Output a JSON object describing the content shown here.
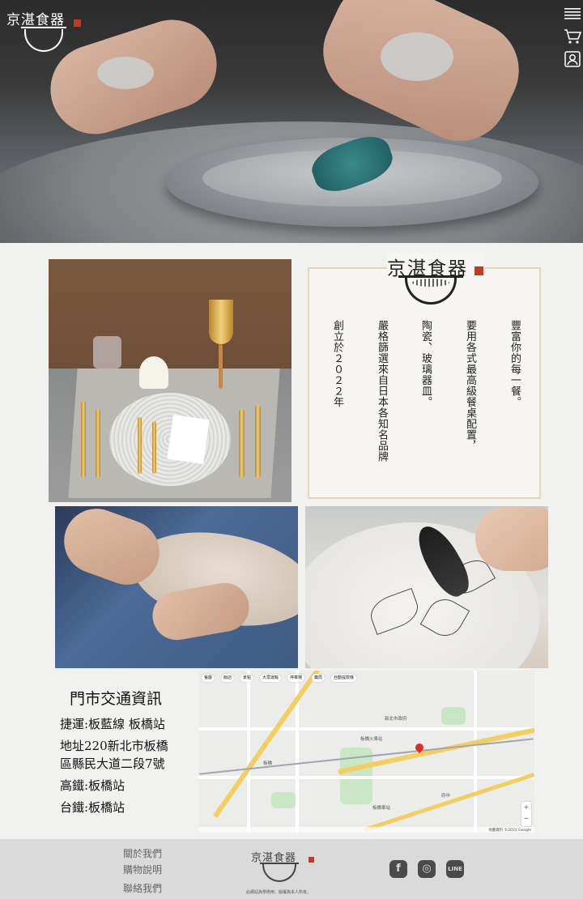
{
  "brand": {
    "logo_text": "京湛食器"
  },
  "nav": {
    "menu_icon": "hamburger-icon",
    "cart_icon": "cart-icon",
    "account_icon": "user-icon"
  },
  "intro": {
    "columns": [
      "豐富你的每一餐。",
      "要用各式最高級餐桌配置，",
      "陶瓷、玻璃器皿。",
      "嚴格篩選來自日本各知名品牌",
      "創立於２０２２年"
    ]
  },
  "store": {
    "title": "門市交通資訊",
    "mrt": "捷運:板藍線 板橋站",
    "address_line1": "地址220新北市板橋",
    "address_line2": "區縣民大道二段7號",
    "hsr": "高鐵:板橋站",
    "tra": "台鐵:板橋站"
  },
  "map": {
    "chips": [
      "餐廳",
      "飯店",
      "景點",
      "大眾運輸",
      "停車場",
      "藥局",
      "自動提款機"
    ],
    "labels": [
      "板橋火車站",
      "新北市政府",
      "板橋車站",
      "府中",
      "板橋"
    ],
    "attribution": "地圖資料 ©2022 Google"
  },
  "footer": {
    "links": [
      "關於我們",
      "購物說明",
      "聯絡我們"
    ],
    "copyright": "此網站為學術用、版權為本人所有。",
    "social": [
      {
        "name": "facebook-icon",
        "glyph": "f"
      },
      {
        "name": "instagram-icon",
        "glyph": "◎"
      },
      {
        "name": "line-icon",
        "glyph": "LINE"
      }
    ]
  }
}
